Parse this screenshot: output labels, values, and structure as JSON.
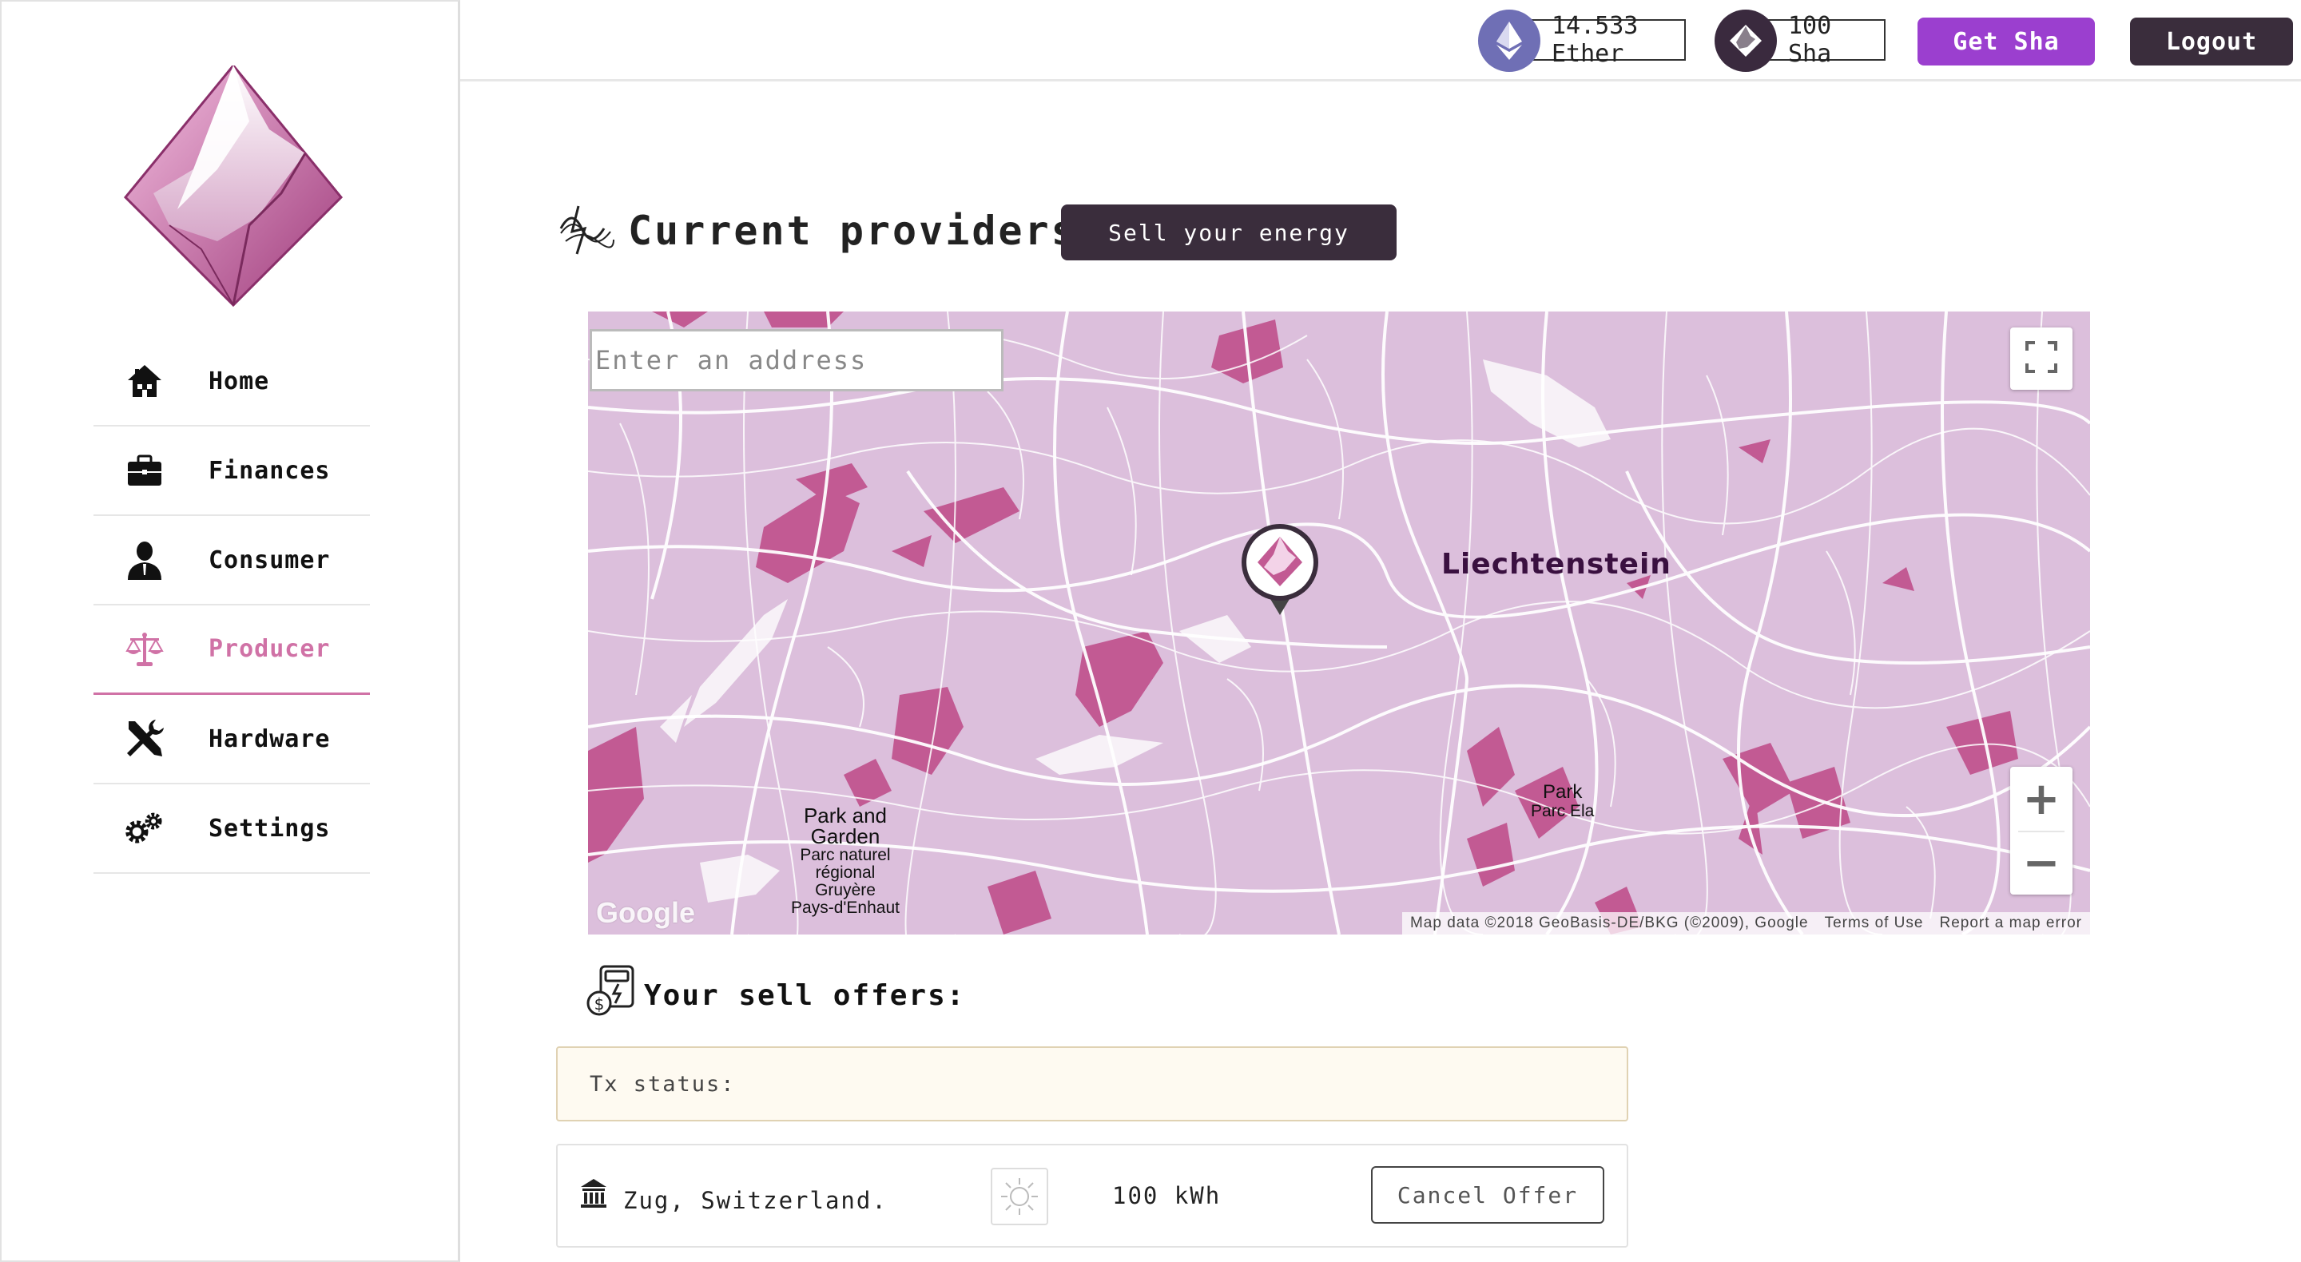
{
  "sidebar": {
    "items": [
      {
        "label": "Home",
        "icon": "house-icon",
        "active": false
      },
      {
        "label": "Finances",
        "icon": "briefcase-icon",
        "active": false
      },
      {
        "label": "Consumer",
        "icon": "person-icon",
        "active": false
      },
      {
        "label": "Producer",
        "icon": "scales-icon",
        "active": true
      },
      {
        "label": "Hardware",
        "icon": "tools-icon",
        "active": false
      },
      {
        "label": "Settings",
        "icon": "gears-icon",
        "active": false
      }
    ]
  },
  "topbar": {
    "ether_balance": "14.533 Ether",
    "sha_balance": "100 Sha",
    "get_sha_label": "Get Sha",
    "logout_label": "Logout"
  },
  "main": {
    "heading": "Current providers",
    "sell_button_label": "Sell your energy",
    "map": {
      "search_placeholder": "Enter an address",
      "region_label": "Liechtenstein",
      "park1_title": "Park and Garden",
      "park1_line1": "Parc naturel",
      "park1_line2": "régional",
      "park1_line3": "Gruyère",
      "park1_line4": "Pays-d'Enhaut",
      "park2_title": "Park",
      "park2_sub": "Parc Ela",
      "google_logo": "Google",
      "attribution": "Map data ©2018 GeoBasis-DE/BKG (©2009), Google",
      "terms": "Terms of Use",
      "report": "Report a map error"
    },
    "offers_title": "Your sell offers:",
    "tx_status_label": "Tx status:",
    "offers": [
      {
        "location": "Zug, Switzerland.",
        "amount": "100 kWh",
        "cancel_label": "Cancel Offer",
        "type_icon": "sun-icon"
      }
    ]
  },
  "colors": {
    "accent_pink": "#d072a6",
    "get_sha_purple": "#9b3fcf",
    "dark_button": "#3a2d3c",
    "map_base": "#dcbfdc",
    "map_dark": "#c25a93"
  }
}
